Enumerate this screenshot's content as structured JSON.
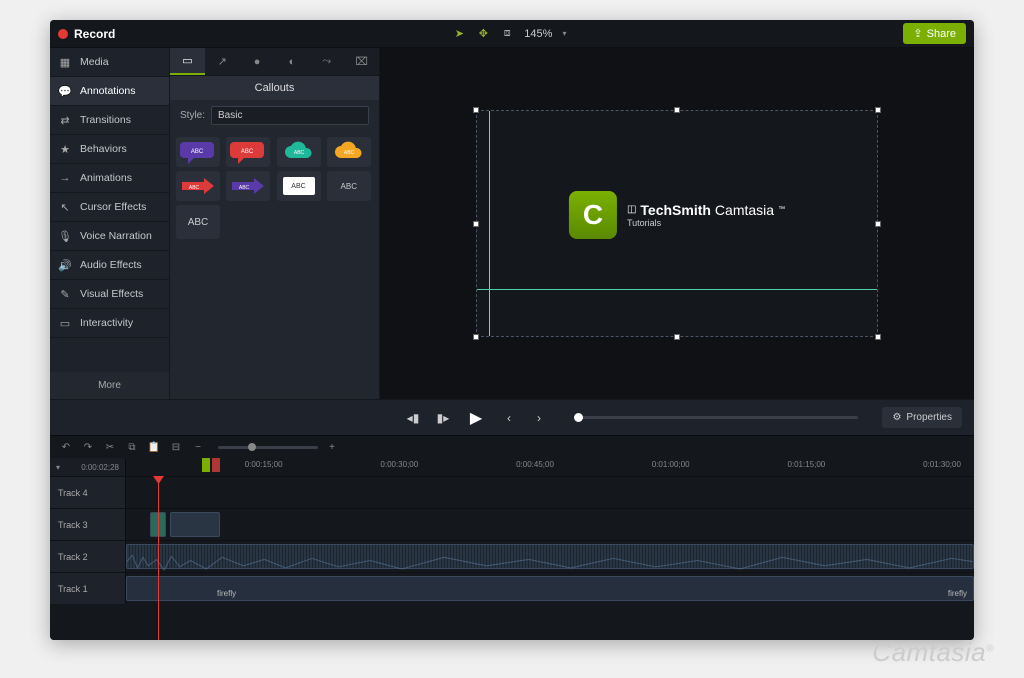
{
  "topbar": {
    "record_label": "Record",
    "zoom": "145%",
    "share_label": "Share"
  },
  "sidebar": {
    "items": [
      {
        "label": "Media"
      },
      {
        "label": "Annotations"
      },
      {
        "label": "Transitions"
      },
      {
        "label": "Behaviors"
      },
      {
        "label": "Animations"
      },
      {
        "label": "Cursor Effects"
      },
      {
        "label": "Voice Narration"
      },
      {
        "label": "Audio Effects"
      },
      {
        "label": "Visual Effects"
      },
      {
        "label": "Interactivity"
      }
    ],
    "more_label": "More",
    "active_index": 1
  },
  "annotations": {
    "header": "Callouts",
    "style_label": "Style:",
    "style_value": "Basic",
    "callouts": [
      {
        "bg": "#5a3aa8",
        "shape": "speech",
        "text": "ABC"
      },
      {
        "bg": "#dd3a3a",
        "shape": "speech",
        "text": "ABC"
      },
      {
        "bg": "#1fb89a",
        "shape": "cloud",
        "text": "ABC"
      },
      {
        "bg": "#f5a623",
        "shape": "cloud",
        "text": "ABC"
      },
      {
        "bg": "#dd3a3a",
        "shape": "arrow",
        "text": "ABC"
      },
      {
        "bg": "#5a3aa8",
        "shape": "arrow",
        "text": "ABC"
      },
      {
        "bg": "#ffffff",
        "shape": "rect",
        "text": "ABC"
      },
      {
        "bg": "transparent",
        "shape": "text",
        "text": "ABC"
      },
      {
        "bg": "transparent",
        "shape": "text-big",
        "text": "ABC"
      }
    ]
  },
  "canvas": {
    "brand_main": "TechSmith",
    "brand_product": "Camtasia",
    "brand_sub": "Tutorials",
    "logo_letter": "C"
  },
  "playback": {
    "properties_label": "Properties"
  },
  "timeline": {
    "timecode": "0:00:02;28",
    "ruler": [
      "0:00:15;00",
      "0:00:30;00",
      "0:00:45;00",
      "0:01:00;00",
      "0:01:15;00",
      "0:01:30;00"
    ],
    "tracks": [
      {
        "name": "Track 4"
      },
      {
        "name": "Track 3"
      },
      {
        "name": "Track 2"
      },
      {
        "name": "Track 1"
      }
    ],
    "clip_label_1": "firefly",
    "clip_label_2": "firefly"
  },
  "watermark": "Camtasia"
}
